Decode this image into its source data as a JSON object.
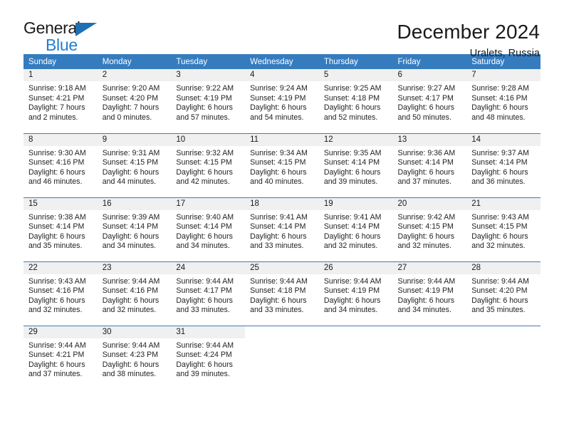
{
  "brand": {
    "word1": "General",
    "word2": "Blue",
    "triangle": "brand-triangle-icon",
    "accent_color": "#1f7fd0"
  },
  "header": {
    "title": "December 2024",
    "subtitle": "Uralets, Russia"
  },
  "theme": {
    "header_row_bg": "#357cbf",
    "row_divider": "#3c7cbc",
    "daynum_shade": "#f0f0f0"
  },
  "weekday_headers": [
    "Sunday",
    "Monday",
    "Tuesday",
    "Wednesday",
    "Thursday",
    "Friday",
    "Saturday"
  ],
  "weeks": [
    [
      {
        "day": "1",
        "sunrise": "Sunrise: 9:18 AM",
        "sunset": "Sunset: 4:21 PM",
        "daylight1": "Daylight: 7 hours",
        "daylight2": "and 2 minutes."
      },
      {
        "day": "2",
        "sunrise": "Sunrise: 9:20 AM",
        "sunset": "Sunset: 4:20 PM",
        "daylight1": "Daylight: 7 hours",
        "daylight2": "and 0 minutes."
      },
      {
        "day": "3",
        "sunrise": "Sunrise: 9:22 AM",
        "sunset": "Sunset: 4:19 PM",
        "daylight1": "Daylight: 6 hours",
        "daylight2": "and 57 minutes."
      },
      {
        "day": "4",
        "sunrise": "Sunrise: 9:24 AM",
        "sunset": "Sunset: 4:19 PM",
        "daylight1": "Daylight: 6 hours",
        "daylight2": "and 54 minutes."
      },
      {
        "day": "5",
        "sunrise": "Sunrise: 9:25 AM",
        "sunset": "Sunset: 4:18 PM",
        "daylight1": "Daylight: 6 hours",
        "daylight2": "and 52 minutes."
      },
      {
        "day": "6",
        "sunrise": "Sunrise: 9:27 AM",
        "sunset": "Sunset: 4:17 PM",
        "daylight1": "Daylight: 6 hours",
        "daylight2": "and 50 minutes."
      },
      {
        "day": "7",
        "sunrise": "Sunrise: 9:28 AM",
        "sunset": "Sunset: 4:16 PM",
        "daylight1": "Daylight: 6 hours",
        "daylight2": "and 48 minutes."
      }
    ],
    [
      {
        "day": "8",
        "sunrise": "Sunrise: 9:30 AM",
        "sunset": "Sunset: 4:16 PM",
        "daylight1": "Daylight: 6 hours",
        "daylight2": "and 46 minutes."
      },
      {
        "day": "9",
        "sunrise": "Sunrise: 9:31 AM",
        "sunset": "Sunset: 4:15 PM",
        "daylight1": "Daylight: 6 hours",
        "daylight2": "and 44 minutes."
      },
      {
        "day": "10",
        "sunrise": "Sunrise: 9:32 AM",
        "sunset": "Sunset: 4:15 PM",
        "daylight1": "Daylight: 6 hours",
        "daylight2": "and 42 minutes."
      },
      {
        "day": "11",
        "sunrise": "Sunrise: 9:34 AM",
        "sunset": "Sunset: 4:15 PM",
        "daylight1": "Daylight: 6 hours",
        "daylight2": "and 40 minutes."
      },
      {
        "day": "12",
        "sunrise": "Sunrise: 9:35 AM",
        "sunset": "Sunset: 4:14 PM",
        "daylight1": "Daylight: 6 hours",
        "daylight2": "and 39 minutes."
      },
      {
        "day": "13",
        "sunrise": "Sunrise: 9:36 AM",
        "sunset": "Sunset: 4:14 PM",
        "daylight1": "Daylight: 6 hours",
        "daylight2": "and 37 minutes."
      },
      {
        "day": "14",
        "sunrise": "Sunrise: 9:37 AM",
        "sunset": "Sunset: 4:14 PM",
        "daylight1": "Daylight: 6 hours",
        "daylight2": "and 36 minutes."
      }
    ],
    [
      {
        "day": "15",
        "sunrise": "Sunrise: 9:38 AM",
        "sunset": "Sunset: 4:14 PM",
        "daylight1": "Daylight: 6 hours",
        "daylight2": "and 35 minutes."
      },
      {
        "day": "16",
        "sunrise": "Sunrise: 9:39 AM",
        "sunset": "Sunset: 4:14 PM",
        "daylight1": "Daylight: 6 hours",
        "daylight2": "and 34 minutes."
      },
      {
        "day": "17",
        "sunrise": "Sunrise: 9:40 AM",
        "sunset": "Sunset: 4:14 PM",
        "daylight1": "Daylight: 6 hours",
        "daylight2": "and 34 minutes."
      },
      {
        "day": "18",
        "sunrise": "Sunrise: 9:41 AM",
        "sunset": "Sunset: 4:14 PM",
        "daylight1": "Daylight: 6 hours",
        "daylight2": "and 33 minutes."
      },
      {
        "day": "19",
        "sunrise": "Sunrise: 9:41 AM",
        "sunset": "Sunset: 4:14 PM",
        "daylight1": "Daylight: 6 hours",
        "daylight2": "and 32 minutes."
      },
      {
        "day": "20",
        "sunrise": "Sunrise: 9:42 AM",
        "sunset": "Sunset: 4:15 PM",
        "daylight1": "Daylight: 6 hours",
        "daylight2": "and 32 minutes."
      },
      {
        "day": "21",
        "sunrise": "Sunrise: 9:43 AM",
        "sunset": "Sunset: 4:15 PM",
        "daylight1": "Daylight: 6 hours",
        "daylight2": "and 32 minutes."
      }
    ],
    [
      {
        "day": "22",
        "sunrise": "Sunrise: 9:43 AM",
        "sunset": "Sunset: 4:16 PM",
        "daylight1": "Daylight: 6 hours",
        "daylight2": "and 32 minutes."
      },
      {
        "day": "23",
        "sunrise": "Sunrise: 9:44 AM",
        "sunset": "Sunset: 4:16 PM",
        "daylight1": "Daylight: 6 hours",
        "daylight2": "and 32 minutes."
      },
      {
        "day": "24",
        "sunrise": "Sunrise: 9:44 AM",
        "sunset": "Sunset: 4:17 PM",
        "daylight1": "Daylight: 6 hours",
        "daylight2": "and 33 minutes."
      },
      {
        "day": "25",
        "sunrise": "Sunrise: 9:44 AM",
        "sunset": "Sunset: 4:18 PM",
        "daylight1": "Daylight: 6 hours",
        "daylight2": "and 33 minutes."
      },
      {
        "day": "26",
        "sunrise": "Sunrise: 9:44 AM",
        "sunset": "Sunset: 4:19 PM",
        "daylight1": "Daylight: 6 hours",
        "daylight2": "and 34 minutes."
      },
      {
        "day": "27",
        "sunrise": "Sunrise: 9:44 AM",
        "sunset": "Sunset: 4:19 PM",
        "daylight1": "Daylight: 6 hours",
        "daylight2": "and 34 minutes."
      },
      {
        "day": "28",
        "sunrise": "Sunrise: 9:44 AM",
        "sunset": "Sunset: 4:20 PM",
        "daylight1": "Daylight: 6 hours",
        "daylight2": "and 35 minutes."
      }
    ],
    [
      {
        "day": "29",
        "sunrise": "Sunrise: 9:44 AM",
        "sunset": "Sunset: 4:21 PM",
        "daylight1": "Daylight: 6 hours",
        "daylight2": "and 37 minutes."
      },
      {
        "day": "30",
        "sunrise": "Sunrise: 9:44 AM",
        "sunset": "Sunset: 4:23 PM",
        "daylight1": "Daylight: 6 hours",
        "daylight2": "and 38 minutes."
      },
      {
        "day": "31",
        "sunrise": "Sunrise: 9:44 AM",
        "sunset": "Sunset: 4:24 PM",
        "daylight1": "Daylight: 6 hours",
        "daylight2": "and 39 minutes."
      },
      {
        "day": "",
        "sunrise": "",
        "sunset": "",
        "daylight1": "",
        "daylight2": ""
      },
      {
        "day": "",
        "sunrise": "",
        "sunset": "",
        "daylight1": "",
        "daylight2": ""
      },
      {
        "day": "",
        "sunrise": "",
        "sunset": "",
        "daylight1": "",
        "daylight2": ""
      },
      {
        "day": "",
        "sunrise": "",
        "sunset": "",
        "daylight1": "",
        "daylight2": ""
      }
    ]
  ]
}
